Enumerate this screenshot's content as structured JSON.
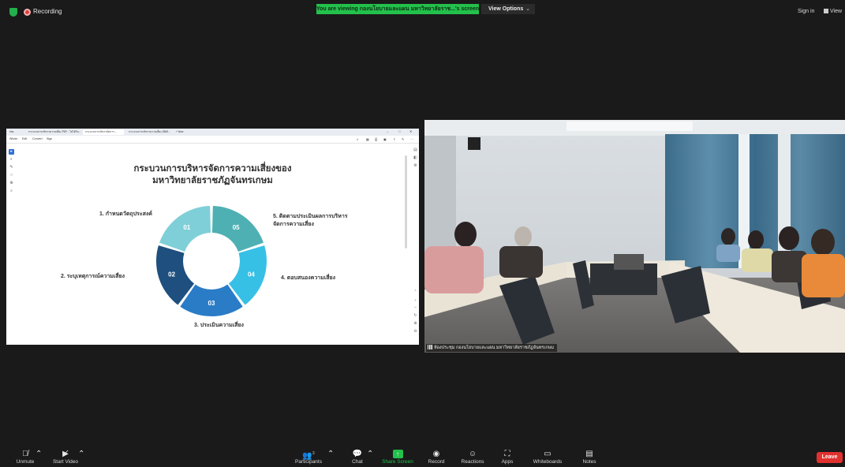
{
  "topbar": {
    "recording_label": "Recording",
    "viewing_banner": "You are viewing กองนโยบายและแผน มหาวิทยาลัยราช...'s screen",
    "view_options_label": "View Options",
    "sign_in_label": "Sign in",
    "view_label": "View"
  },
  "shared_screen": {
    "tabs": [
      "Ims",
      "กระบวนการบริหารความเสี่ยง PDF - ไม่ได้รับ...",
      "กระบวนการบริหารจัดการ...",
      "กระบวนการบริหารความเสี่ยง 2565...",
      "+ New"
    ],
    "menu": [
      "Whole",
      "Edit",
      "Convert",
      "Sign"
    ],
    "slide": {
      "title_line1": "กระบวนการบริหารจัดการความเสี่ยงของ",
      "title_line2": "มหาวิทยาลัยราชภัฏจันทรเกษม",
      "steps": {
        "s1": "1. กำหนดวัตถุประสงค์",
        "s2": "2. ระบุเหตุการณ์ความเสี่ยง",
        "s3": "3. ประเมินความเสี่ยง",
        "s4": "4. ตอบสนองความเสี่ยง",
        "s5_line1": "5. ติดตามประเมินผลการบริหาร",
        "s5_line2": "จัดการความเสี่ยง"
      },
      "cycle_labels": [
        "01",
        "02",
        "03",
        "04",
        "05"
      ],
      "cycle_colors": [
        "#7fcfd8",
        "#1e4f7e",
        "#2a7cc7",
        "#37c0e6",
        "#4fb0b3"
      ]
    }
  },
  "camera": {
    "participant_label": "ห้องประชุม กองนโยบายและแผน มหาวิทยาลัยราชภัฏจันทรเกษม"
  },
  "toolbar": {
    "unmute": "Unmute",
    "start_video": "Start Video",
    "participants": "Participants",
    "participants_count": "3",
    "chat": "Chat",
    "share_screen": "Share Screen",
    "record": "Record",
    "reactions": "Reactions",
    "apps": "Apps",
    "whiteboards": "Whiteboards",
    "notes": "Notes",
    "leave": "Leave"
  },
  "colors": {
    "accent_green": "#23c14b",
    "leave_red": "#e0312f"
  }
}
